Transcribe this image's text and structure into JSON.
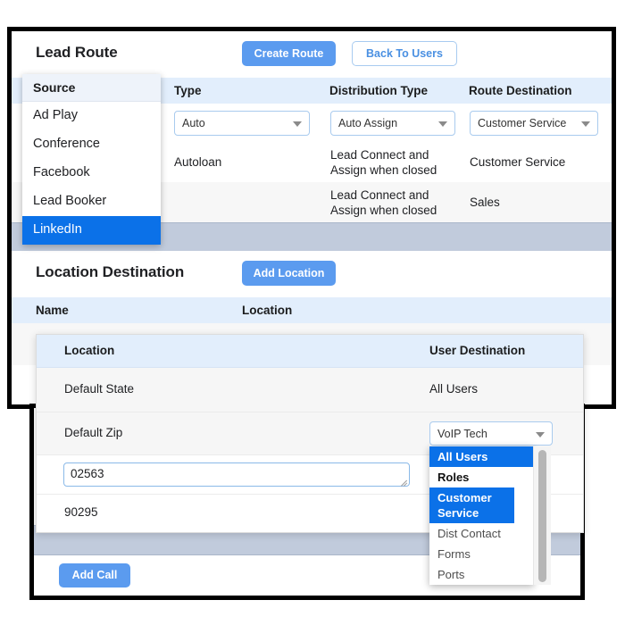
{
  "lead_route": {
    "title": "Lead Route",
    "create_button": "Create Route",
    "back_button": "Back To Users",
    "columns": [
      "Source",
      "Type",
      "Distribution Type",
      "Route Destination"
    ],
    "editor_row": {
      "type": "Auto",
      "distribution_type": "Auto Assign",
      "route_destination": "Customer Service"
    },
    "rows": [
      {
        "source": "",
        "type": "Autoloan",
        "distribution_type": "Lead Connect and Assign when closed",
        "route_destination": "Customer Service"
      },
      {
        "source": "",
        "type": "",
        "distribution_type": "Lead Connect and Assign when closed",
        "route_destination": "Sales"
      }
    ]
  },
  "source_dropdown": {
    "header": "Source",
    "options": [
      "Ad Play",
      "Conference",
      "Facebook",
      "Lead Booker",
      "LinkedIn"
    ],
    "selected": "LinkedIn"
  },
  "location_destination": {
    "title": "Location Destination",
    "add_button": "Add Location",
    "columns": [
      "Name",
      "Location"
    ]
  },
  "inner_panel": {
    "columns": [
      "Location",
      "User Destination"
    ],
    "rows": [
      {
        "location": "Default State",
        "user_destination": "All Users"
      },
      {
        "location": "Default Zip",
        "user_destination": "VoIP Tech"
      }
    ],
    "zip_input_value": "02563",
    "zip_text_value": "90295"
  },
  "user_destination_dropdown": {
    "selected": "All Users",
    "group_label": "Roles",
    "highlighted": "Customer Service",
    "options": [
      "Dist Contact",
      "Forms",
      "Ports"
    ]
  },
  "footer": {
    "add_call_button": "Add Call"
  },
  "colors": {
    "primary_blue": "#5b9bef",
    "select_blue": "#0b71e8",
    "header_blue": "#e2eefc",
    "band_gray": "#c1cbdc",
    "frame_black": "#000000"
  }
}
